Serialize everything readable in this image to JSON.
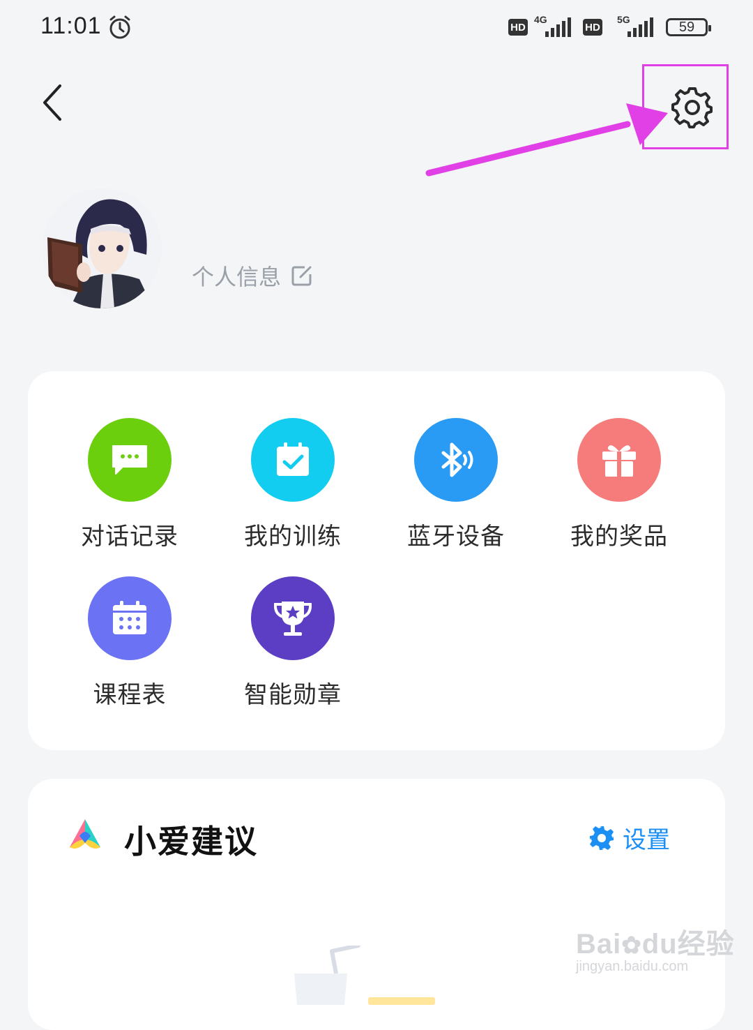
{
  "status_bar": {
    "time": "11:01",
    "hd_badge": "HD",
    "network_1": "4G",
    "network_2": "5G",
    "battery": "59"
  },
  "header": {
    "back_icon": "chevron-left-icon",
    "settings_icon": "gear-icon",
    "highlight_color": "#e040e6"
  },
  "profile": {
    "info_label": "个人信息",
    "edit_icon": "edit-icon"
  },
  "features": [
    {
      "label": "对话记录",
      "icon": "chat-icon",
      "color": "#6ccf0e"
    },
    {
      "label": "我的训练",
      "icon": "calendar-check-icon",
      "color": "#12cdf0"
    },
    {
      "label": "蓝牙设备",
      "icon": "bluetooth-icon",
      "color": "#2a9bf4"
    },
    {
      "label": "我的奖品",
      "icon": "gift-icon",
      "color": "#f67b7b"
    },
    {
      "label": "课程表",
      "icon": "schedule-icon",
      "color": "#6b73f4"
    },
    {
      "label": "智能勋章",
      "icon": "trophy-icon",
      "color": "#5b3ec4"
    }
  ],
  "advice": {
    "title": "小爱建议",
    "settings_label": "设置",
    "accent": "#1c8ff5"
  },
  "watermark": {
    "brand": "Bai",
    "brand2": "du",
    "cn": "经验",
    "url": "jingyan.baidu.com"
  }
}
